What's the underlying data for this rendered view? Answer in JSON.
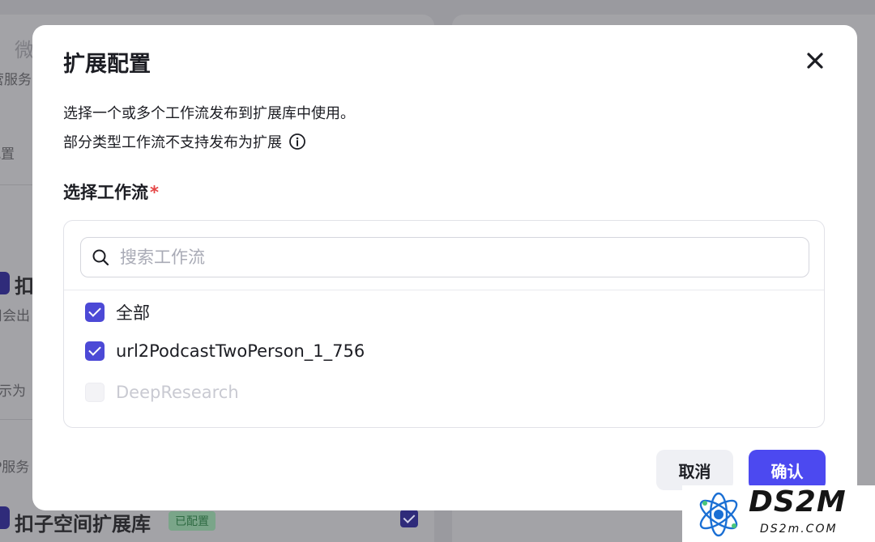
{
  "background": {
    "snippets": [
      "微",
      "营服务",
      "配置",
      "扣",
      "用会出",
      "示为",
      "P服务",
      "扣子空间扩展库"
    ],
    "badge": "已配置"
  },
  "modal": {
    "title": "扩展配置",
    "close_icon": "close-icon",
    "description_line1": "选择一个或多个工作流发布到扩展库中使用。",
    "description_line2": "部分类型工作流不支持发布为扩展",
    "info_icon": "info-icon",
    "field_label": "选择工作流",
    "required_mark": "*",
    "search": {
      "placeholder": "搜索工作流",
      "value": ""
    },
    "workflows": [
      {
        "label": "全部",
        "checked": true,
        "disabled": false
      },
      {
        "label": "url2PodcastTwoPerson_1_756",
        "checked": true,
        "disabled": false
      },
      {
        "label": "DeepResearch",
        "checked": false,
        "disabled": true
      }
    ],
    "buttons": {
      "cancel": "取消",
      "confirm": "确认"
    }
  },
  "watermark": {
    "main": "DS2M",
    "sub": "DS2m.COM"
  },
  "colors": {
    "accent": "#4c49f0",
    "checkbox": "#4c49d6",
    "required": "#e54545",
    "overlay": "#9a9a9f"
  }
}
